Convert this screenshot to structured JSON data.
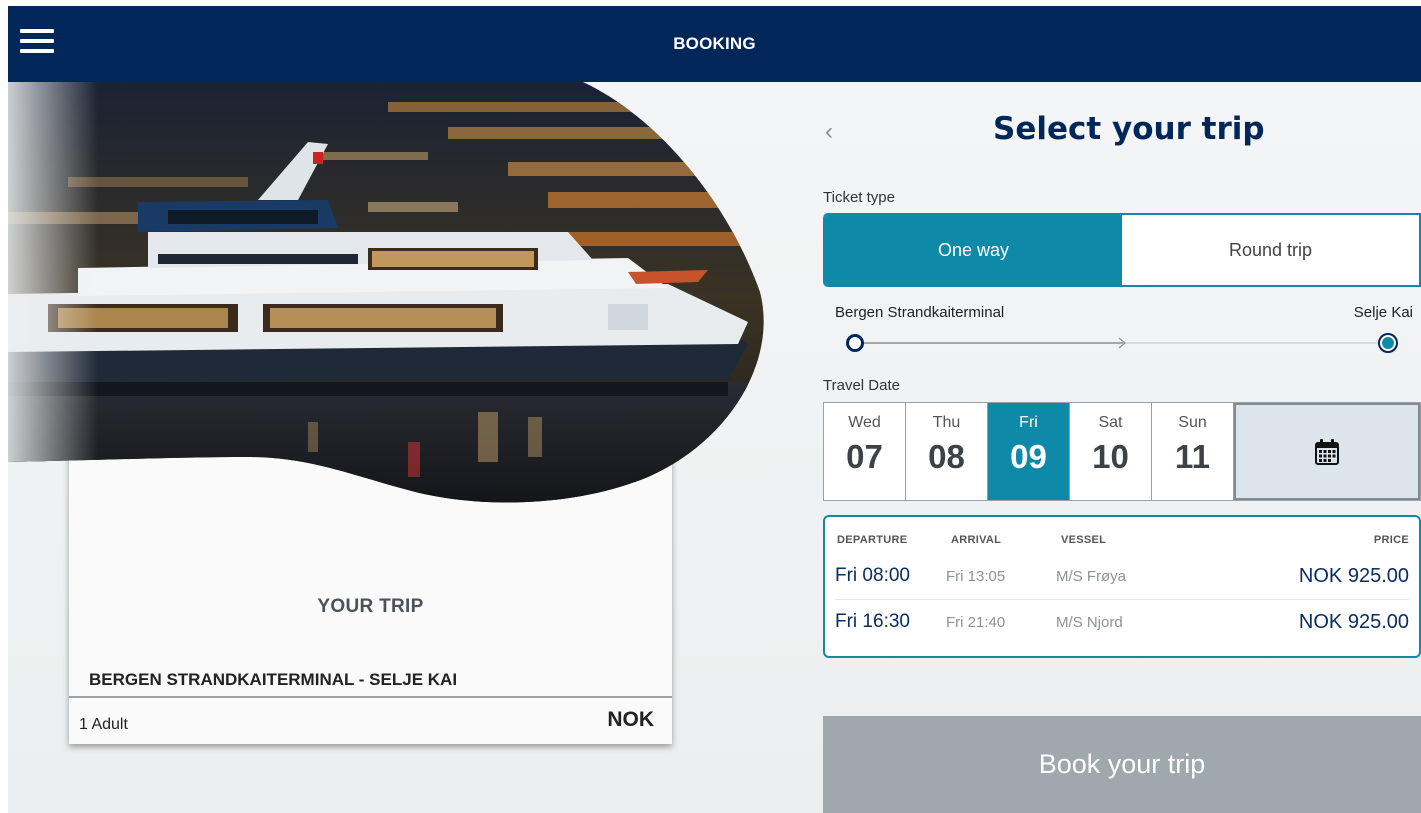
{
  "header": {
    "title": "BOOKING",
    "menu_icon": "hamburger-menu-icon"
  },
  "trip_summary": {
    "heading": "YOUR TRIP",
    "route": "BERGEN STRANDKAITERMINAL - SELJE KAI",
    "passengers": "1 Adult",
    "currency": "NOK"
  },
  "trip_selection": {
    "back_icon": "chevron-left-icon",
    "title": "Select your trip",
    "ticket_type_label": "Ticket type",
    "ticket_types": [
      {
        "label": "One way",
        "selected": true
      },
      {
        "label": "Round trip",
        "selected": false
      }
    ],
    "from_stop": "Bergen Strandkaiterminal",
    "to_stop": "Selje Kai",
    "travel_date_label": "Travel Date",
    "dates": [
      {
        "dow": "Wed",
        "day": "07",
        "selected": false
      },
      {
        "dow": "Thu",
        "day": "08",
        "selected": false
      },
      {
        "dow": "Fri",
        "day": "09",
        "selected": true
      },
      {
        "dow": "Sat",
        "day": "10",
        "selected": false
      },
      {
        "dow": "Sun",
        "day": "11",
        "selected": false
      }
    ],
    "calendar_icon": "calendar-icon"
  },
  "departures": {
    "columns": [
      "DEPARTURE",
      "ARRIVAL",
      "VESSEL",
      "PRICE"
    ],
    "rows": [
      {
        "departure": "Fri 08:00",
        "arrival": "Fri 13:05",
        "vessel": "M/S Frøya",
        "price": "NOK 925.00"
      },
      {
        "departure": "Fri 16:30",
        "arrival": "Fri 21:40",
        "vessel": "M/S Njord",
        "price": "NOK 925.00"
      }
    ]
  },
  "book_button": "Book your trip",
  "colors": {
    "header_bg": "#00265a",
    "accent": "#0e8aa8",
    "title": "#00265a",
    "book_button_disabled": "#9fa8ac"
  }
}
